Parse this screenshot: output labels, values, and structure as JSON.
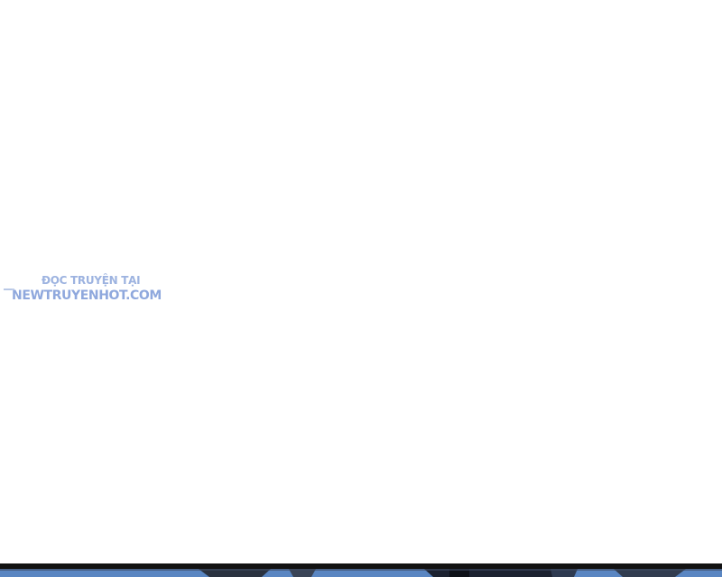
{
  "watermark": {
    "line1": "ĐỌC TRUYỆN TẠI",
    "line2": "NEWTRUYENHOT.COM",
    "color": "#8fa8dd"
  },
  "colors": {
    "background": "#ffffff",
    "panel_border": "#121212",
    "panel_sky": "#5a86c2"
  }
}
